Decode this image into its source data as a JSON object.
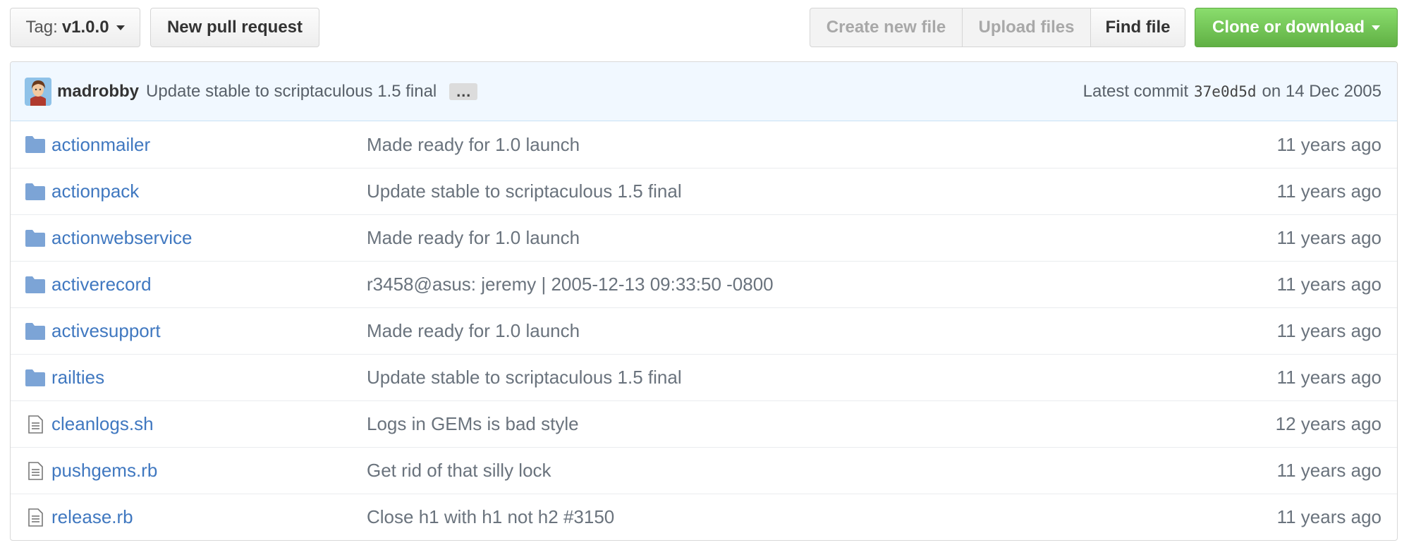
{
  "toolbar": {
    "tag_label": "Tag:",
    "tag_value": "v1.0.0",
    "new_pull_request": "New pull request",
    "create_new_file": "Create new file",
    "upload_files": "Upload files",
    "find_file": "Find file",
    "clone_or_download": "Clone or download"
  },
  "commit": {
    "author": "madrobby",
    "message": "Update stable to scriptaculous 1.5 final",
    "ellipsis": "…",
    "latest_prefix": "Latest commit",
    "sha": "37e0d5d",
    "date_text": "on 14 Dec 2005"
  },
  "files": [
    {
      "type": "folder",
      "name": "actionmailer",
      "message": "Made ready for 1.0 launch",
      "age": "11 years ago"
    },
    {
      "type": "folder",
      "name": "actionpack",
      "message": "Update stable to scriptaculous 1.5 final",
      "age": "11 years ago"
    },
    {
      "type": "folder",
      "name": "actionwebservice",
      "message": "Made ready for 1.0 launch",
      "age": "11 years ago"
    },
    {
      "type": "folder",
      "name": "activerecord",
      "message": "r3458@asus: jeremy | 2005-12-13 09:33:50 -0800",
      "age": "11 years ago"
    },
    {
      "type": "folder",
      "name": "activesupport",
      "message": "Made ready for 1.0 launch",
      "age": "11 years ago"
    },
    {
      "type": "folder",
      "name": "railties",
      "message": "Update stable to scriptaculous 1.5 final",
      "age": "11 years ago"
    },
    {
      "type": "file",
      "name": "cleanlogs.sh",
      "message": "Logs in GEMs is bad style",
      "age": "12 years ago"
    },
    {
      "type": "file",
      "name": "pushgems.rb",
      "message": "Get rid of that silly lock",
      "age": "11 years ago"
    },
    {
      "type": "file",
      "name": "release.rb",
      "message": "Close h1 with h1 not h2 #3150",
      "age": "11 years ago"
    }
  ],
  "colors": {
    "link": "#4078c0",
    "folder_icon": "#7ca4d6",
    "clone_green": "#60b044",
    "commit_bar_bg": "#f1f8ff"
  },
  "icons": {
    "folder": "folder-icon",
    "file": "file-icon",
    "caret": "caret-down-icon"
  }
}
